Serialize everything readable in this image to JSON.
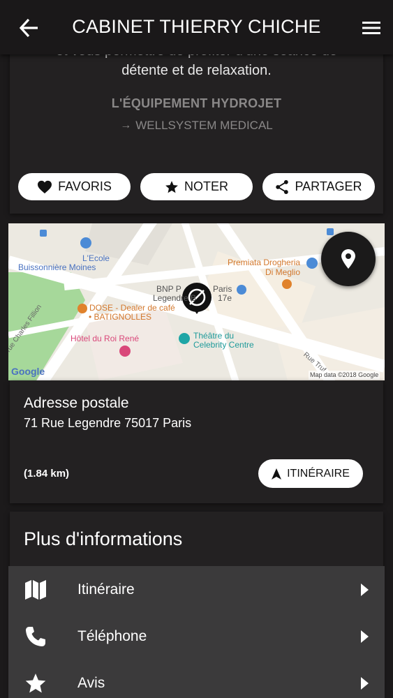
{
  "header": {
    "title": "CABINET THIERRY CHICHE",
    "back_icon": "arrow-left-icon",
    "menu_icon": "hamburger-menu-icon"
  },
  "description": {
    "cut_line": "et vous permettre de profiter d'une séance de",
    "line": "détente et de relaxation."
  },
  "equipment": {
    "title": "L'ÉQUIPEMENT HYDROJET",
    "arrow": "→",
    "brand": "WELLSYSTEM MEDICAL"
  },
  "actions": {
    "favoris": "FAVORIS",
    "noter": "NOTER",
    "partager": "PARTAGER"
  },
  "map": {
    "labels": {
      "ecole": "L'Ecole",
      "buissonniere": "Buissonnière Moines",
      "premiata": "Premiata Drogheria",
      "dimeglio": "Di Meglio",
      "bnp1": "BNP P",
      "paris": "Paris",
      "legendre": "Legendre B",
      "e17": "17e",
      "dose": "DOSE - Dealer de café",
      "batignolles": "• BATIGNOLLES",
      "hotel": "Hôtel du Roi René",
      "theatre1": "Théâtre du",
      "theatre2": "Celebrity Centre",
      "rue_charles": "rue Charles Fillion",
      "rue_truffaut": "Rue Truf",
      "google": "Google",
      "mapdata": "Map data ©2018 Google"
    },
    "colors": {
      "park": "#a6d89a",
      "road": "#ffffff",
      "block": "#ebe8e0",
      "poi_blue": "#4c8bd6",
      "poi_orange": "#e0822c",
      "poi_pink": "#d9487a",
      "poi_teal": "#1ea6a6"
    }
  },
  "address": {
    "heading": "Adresse postale",
    "value": "71 Rue Legendre 75017 Paris",
    "distance": "(1.84 km)",
    "itinerary_button": "ITINÉRAIRE"
  },
  "info": {
    "heading": "Plus d'informations",
    "items": [
      {
        "label": "Itinéraire",
        "icon": "map-icon"
      },
      {
        "label": "Téléphone",
        "icon": "phone-icon"
      },
      {
        "label": "Avis",
        "icon": "star-icon"
      }
    ]
  }
}
